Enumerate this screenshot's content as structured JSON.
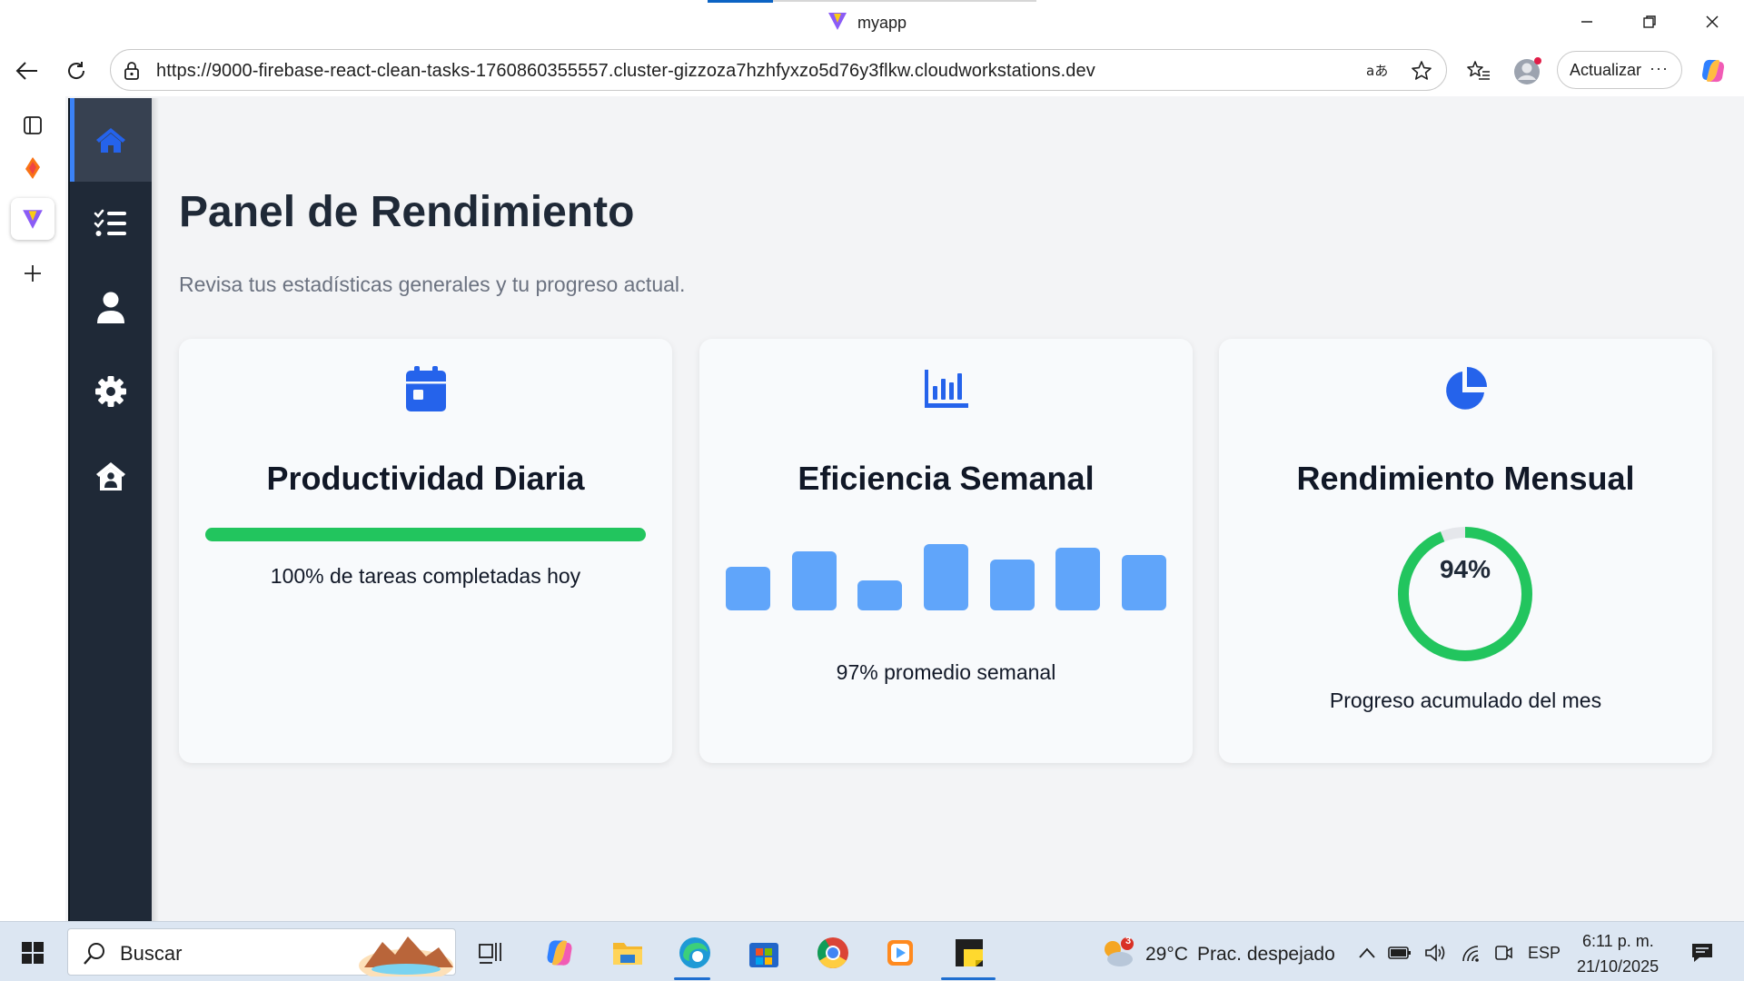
{
  "browser": {
    "title": "myapp",
    "url": "https://9000-firebase-react-clean-tasks-1760860355557.cluster-gizzoza7hzhfyxzo5d76y3flkw.cloudworkstations.dev",
    "update_label": "Actualizar",
    "more_label": "···"
  },
  "sidebar": {
    "items": [
      {
        "name": "home",
        "icon": "home-icon",
        "active": true
      },
      {
        "name": "tasks",
        "icon": "list-check-icon",
        "active": false
      },
      {
        "name": "profile",
        "icon": "user-icon",
        "active": false
      },
      {
        "name": "settings",
        "icon": "gear-icon",
        "active": false
      },
      {
        "name": "team",
        "icon": "house-user-icon",
        "active": false
      }
    ]
  },
  "main": {
    "title": "Panel de Rendimiento",
    "subtitle": "Revisa tus estadísticas generales y tu progreso actual.",
    "cards": [
      {
        "icon": "calendar-icon",
        "title": "Productividad Diaria",
        "progress": 100,
        "caption": "100% de tareas completadas hoy"
      },
      {
        "icon": "bar-chart-icon",
        "title": "Eficiencia Semanal",
        "bar_levels": [
          0.49,
          0.66,
          0.33,
          0.74,
          0.57,
          0.7,
          0.62
        ],
        "caption": "97% promedio semanal"
      },
      {
        "icon": "pie-chart-icon",
        "title": "Rendimiento Mensual",
        "percent": 94,
        "percent_label": "94%",
        "caption": "Progreso acumulado del mes"
      }
    ]
  },
  "taskbar": {
    "search_placeholder": "Buscar",
    "weather_badge": "3",
    "weather_temp": "29°C",
    "weather_desc": "Prac. despejado",
    "language": "ESP",
    "time": "6:11 p. m.",
    "date": "21/10/2025"
  },
  "colors": {
    "accent": "#2563eb",
    "sidebar_bg": "#1f2937",
    "success": "#22c55e",
    "bar": "#60a5fa"
  }
}
